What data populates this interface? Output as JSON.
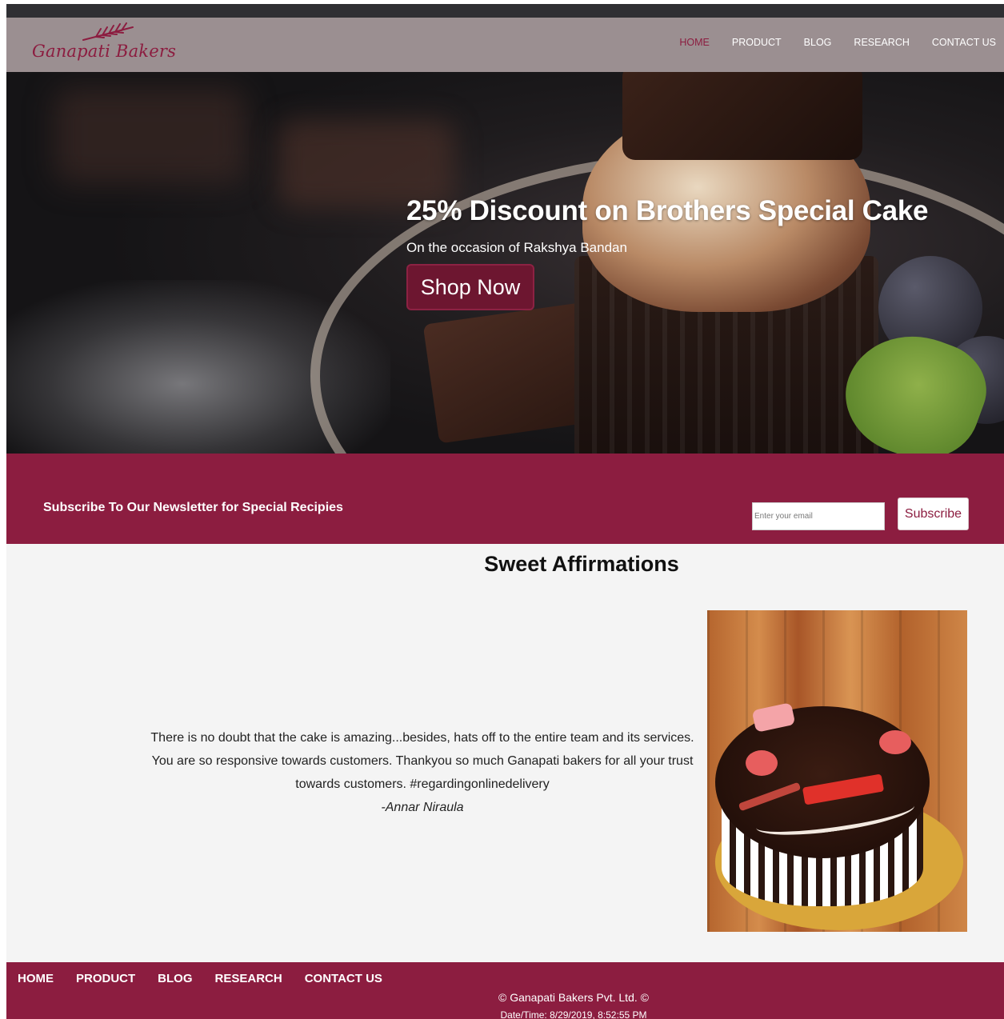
{
  "header": {
    "logo_text": "Ganapati Bakers",
    "nav": [
      "HOME",
      "PRODUCT",
      "BLOG",
      "RESEARCH",
      "CONTACT US"
    ]
  },
  "hero": {
    "title": "25% Discount on Brothers Special Cake",
    "subtitle": "On the occasion of Rakshya Bandan",
    "button": "Shop Now"
  },
  "newsletter": {
    "text": "Subscribe To Our Newsletter for Special Recipies",
    "placeholder": "Enter your email",
    "button": "Subscribe"
  },
  "affirmations": {
    "title": "Sweet Affirmations",
    "quote": "There is no doubt that the cake is amazing...besides, hats off to the entire team and its services. You are so responsive towards customers. Thankyou so much Ganapati bakers for all your trust towards customers. #regardingonlinedelivery",
    "author": "-Annar Niraula"
  },
  "footer": {
    "nav": [
      "HOME",
      "PRODUCT",
      "BLOG",
      "RESEARCH",
      "CONTACT US"
    ],
    "copyright": "© Ganapati Bakers Pvt. Ltd. ©",
    "datetime": "Date/Time: 8/29/2019, 8:52:55 PM"
  },
  "colors": {
    "brand": "#8c1d40",
    "header_bg": "#9b8f91",
    "button_dark": "#6d1630"
  }
}
